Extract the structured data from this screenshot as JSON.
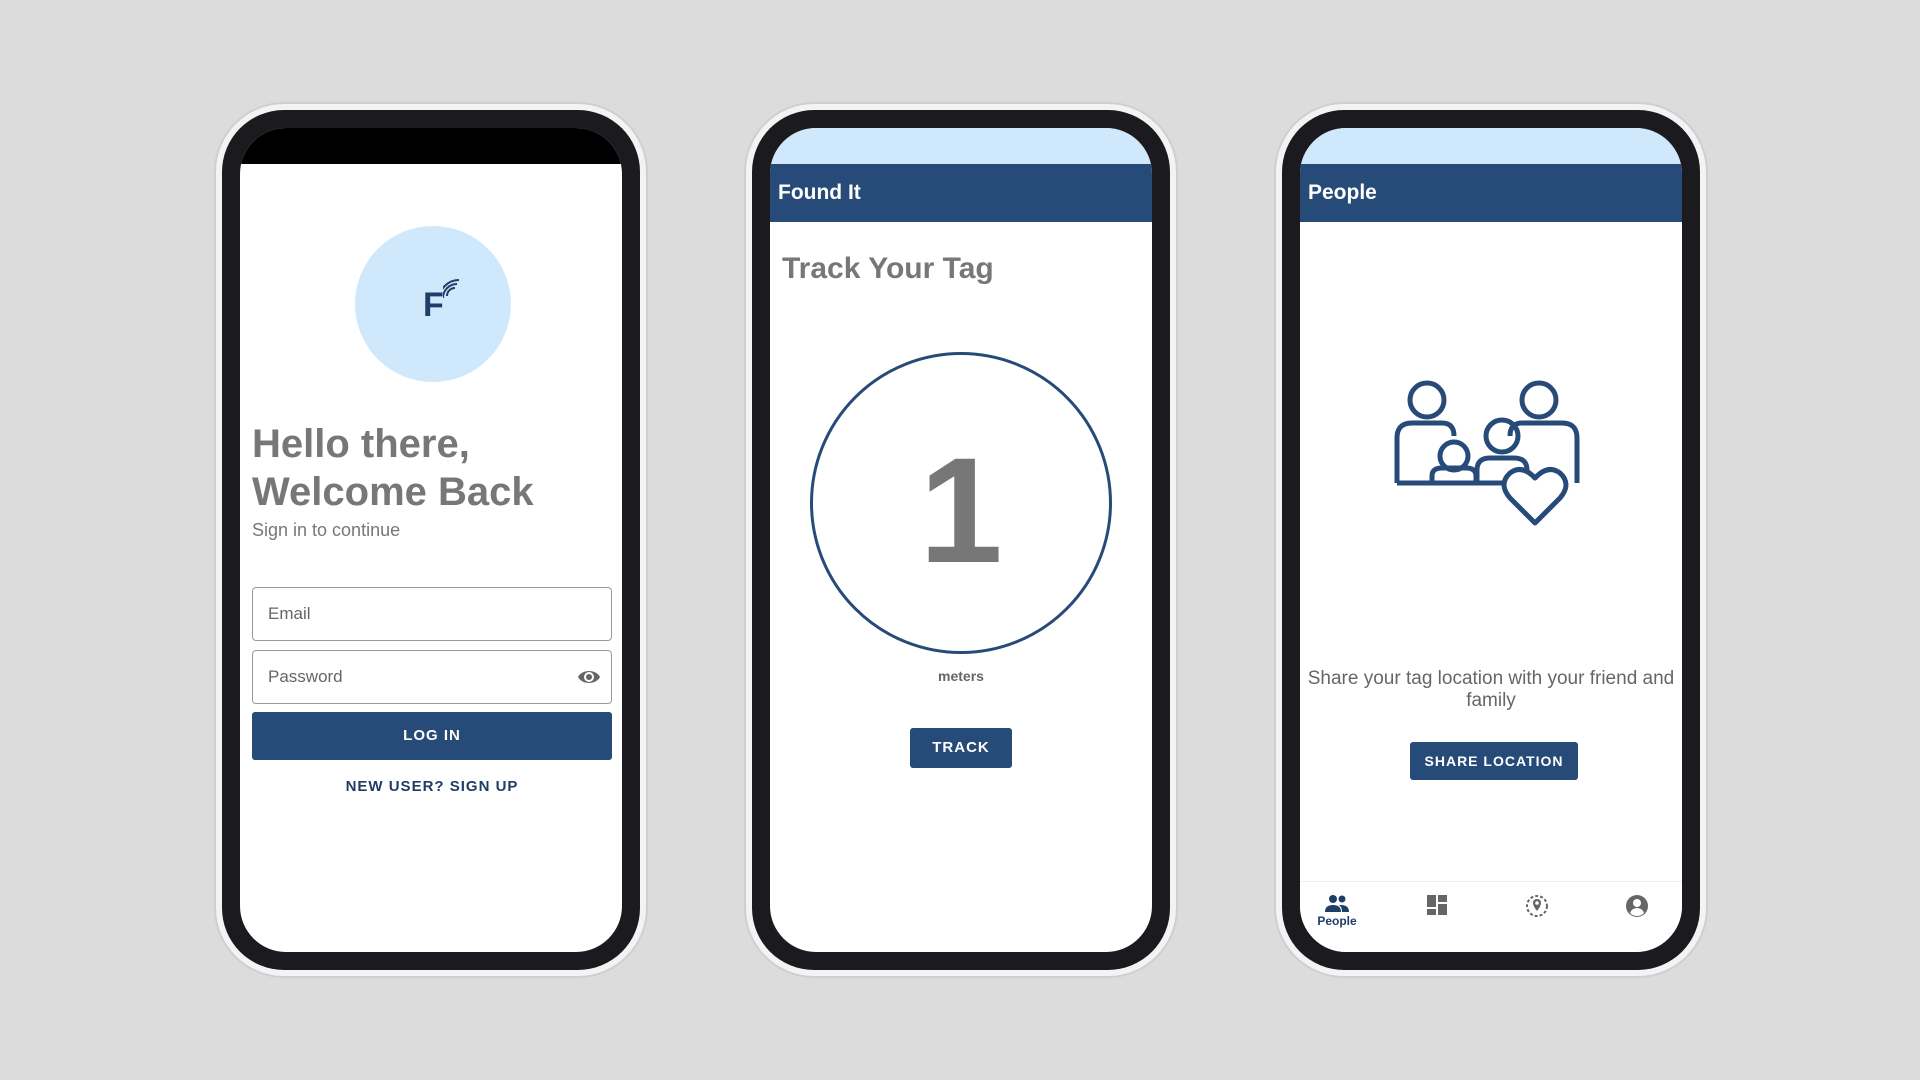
{
  "login_screen": {
    "logo_letter": "F",
    "greeting": "Hello there, Welcome Back",
    "subtitle": "Sign in to continue",
    "email_placeholder": "Email",
    "password_placeholder": "Password",
    "login_button": "LOG IN",
    "signup_link": "NEW USER? SIGN UP"
  },
  "track_screen": {
    "app_title": "Found It",
    "heading": "Track Your Tag",
    "distance_value": "1",
    "distance_unit": "meters",
    "track_button": "TRACK"
  },
  "people_screen": {
    "app_title": "People",
    "description": "Share your tag location with your friend and family",
    "share_button": "SHARE LOCATION",
    "nav": [
      {
        "label": "People",
        "icon": "people-icon",
        "active": true
      },
      {
        "label": "",
        "icon": "dashboard-icon",
        "active": false
      },
      {
        "label": "",
        "icon": "location-icon",
        "active": false
      },
      {
        "label": "",
        "icon": "account-icon",
        "active": false
      }
    ]
  },
  "colors": {
    "primary": "#274b78",
    "status_bar": "#cfe8fb",
    "background": "#dcdcdc",
    "logo_bg": "#cfe8fb"
  }
}
